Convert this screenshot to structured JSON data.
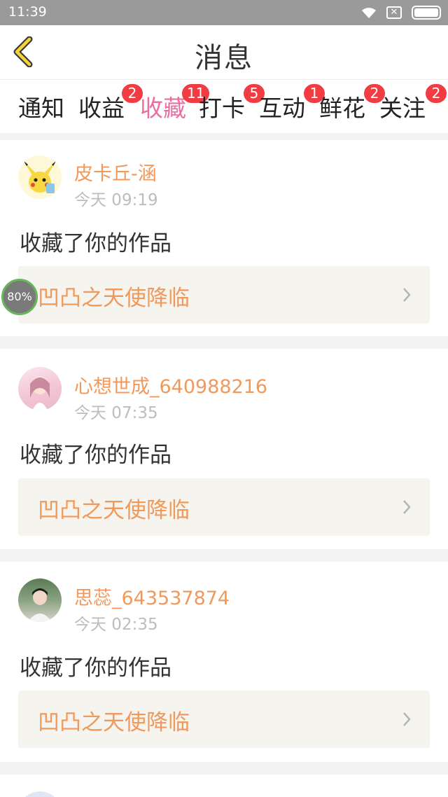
{
  "status_bar": {
    "time": "11:39"
  },
  "header": {
    "title": "消息"
  },
  "tabs": [
    {
      "label": "通知",
      "badge": ""
    },
    {
      "label": "收益",
      "badge": "2"
    },
    {
      "label": "收藏",
      "badge": "11"
    },
    {
      "label": "打卡",
      "badge": "5"
    },
    {
      "label": "互动",
      "badge": "1"
    },
    {
      "label": "鲜花",
      "badge": "2"
    },
    {
      "label": "关注",
      "badge": "2"
    }
  ],
  "active_tab": "收藏",
  "floating_indicator": {
    "label": "80%"
  },
  "items": [
    {
      "username": "皮卡丘-涵",
      "time": "今天 09:19",
      "action": "收藏了你的作品",
      "work_title": "凹凸之天使降临"
    },
    {
      "username": "心想世成_640988216",
      "time": "今天 07:35",
      "action": "收藏了你的作品",
      "work_title": "凹凸之天使降临"
    },
    {
      "username": "思蕊_643537874",
      "time": "今天 02:35",
      "action": "收藏了你的作品",
      "work_title": "凹凸之天使降临"
    }
  ],
  "colors": {
    "accent_pink": "#e86fa0",
    "name_orange": "#f0995a",
    "badge_red": "#f23c43"
  }
}
